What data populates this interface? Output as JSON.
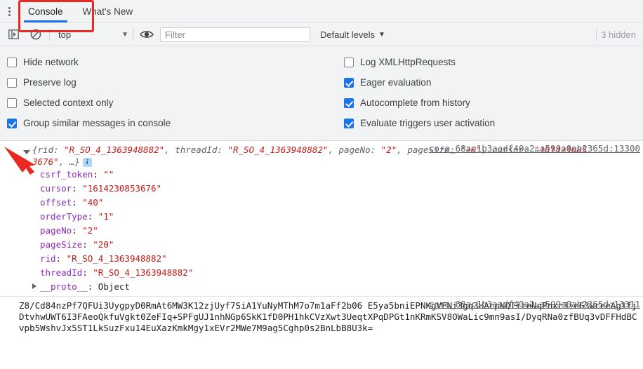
{
  "window": {
    "kebab_icon": "more-vertical-icon"
  },
  "tabs": [
    {
      "label": "Console",
      "active": true
    },
    {
      "label": "What's New",
      "active": false
    }
  ],
  "toolbar": {
    "sidebar_toggle_icon": "show-console-sidebar-icon",
    "clear_icon": "clear-console-icon",
    "context_value": "top",
    "context_caret": "▼",
    "eye_icon": "create-live-expression-icon",
    "filter_placeholder": "Filter",
    "filter_value": "",
    "levels_label": "Default levels",
    "levels_caret": "▼",
    "hidden_label": "3 hidden"
  },
  "settings": {
    "left": [
      {
        "label": "Hide network",
        "checked": false
      },
      {
        "label": "Preserve log",
        "checked": false
      },
      {
        "label": "Selected context only",
        "checked": false
      },
      {
        "label": "Group similar messages in console",
        "checked": true
      }
    ],
    "right": [
      {
        "label": "Log XMLHttpRequests",
        "checked": false
      },
      {
        "label": "Eager evaluation",
        "checked": true
      },
      {
        "label": "Autocomplete from history",
        "checked": true
      },
      {
        "label": "Evaluate triggers user activation",
        "checked": true
      }
    ]
  },
  "console": {
    "object_entry": {
      "source_link": "core_68ac1b3aadf40a2…a599a0ab2365d:13300",
      "preview_line1_parts": [
        {
          "t": "{rid: ",
          "c": "key"
        },
        {
          "t": "\"R_SO_4_1363948882\"",
          "c": "str"
        },
        {
          "t": ", threadId: ",
          "c": "key"
        },
        {
          "t": "\"R_SO_4_1363948882\"",
          "c": "str"
        },
        {
          "t": ", pageNo: ",
          "c": "key"
        },
        {
          "t": "\"2\"",
          "c": "str"
        },
        {
          "t": ", pageSize: ",
          "c": "key"
        },
        {
          "t": "\"20\"",
          "c": "str"
        },
        {
          "t": ", cursor: ",
          "c": "key"
        },
        {
          "t": "\"161423085",
          "c": "str"
        }
      ],
      "preview_line2_parts": [
        {
          "t": "3676\"",
          "c": "str"
        },
        {
          "t": ", …}",
          "c": "key"
        }
      ],
      "info_badge": "i",
      "properties": [
        {
          "name": "csrf_token",
          "value": "\"\""
        },
        {
          "name": "cursor",
          "value": "\"1614230853676\""
        },
        {
          "name": "offset",
          "value": "\"40\""
        },
        {
          "name": "orderType",
          "value": "\"1\""
        },
        {
          "name": "pageNo",
          "value": "\"2\""
        },
        {
          "name": "pageSize",
          "value": "\"20\""
        },
        {
          "name": "rid",
          "value": "\"R_SO_4_1363948882\""
        },
        {
          "name": "threadId",
          "value": "\"R_SO_4_1363948882\""
        }
      ],
      "proto_label": "__proto__",
      "proto_value": "Object"
    },
    "base64_entry": {
      "source_link": "core_68ac1b3aadf40a2…a599a0ab2365d:13311",
      "text": "Z8/Cd84nzPf7QFUi3UygpyD0RmAt6MW3K12zjUyf7SiA1YuNyMThM7o7m1aFf2b06 E5ya5bniEPNKgVFNi3gq3HAcpNQIiteNqPnxr3ieG3wceeAg1fjDtvhwUWT6I3FAeoQkfuVgkt0ZeFIq+SPFgUJ1nhNGp6SkK1fD0PH1hkCVzXwt3UeqtXPqDPGt1nKRmKSV8OWaLic9mn9asI/DyqRNa0zfBUq3vDFFHdBCvpb5WshvJx5ST1LkSuzFxu14EuXazKmkMgy1xEVr2MWe7M9ag5Cghp0s2BnLbB8U3k="
    }
  },
  "annotations": {
    "tab_highlight_color": "#ea2a22",
    "arrow_color": "#ea2a22"
  }
}
